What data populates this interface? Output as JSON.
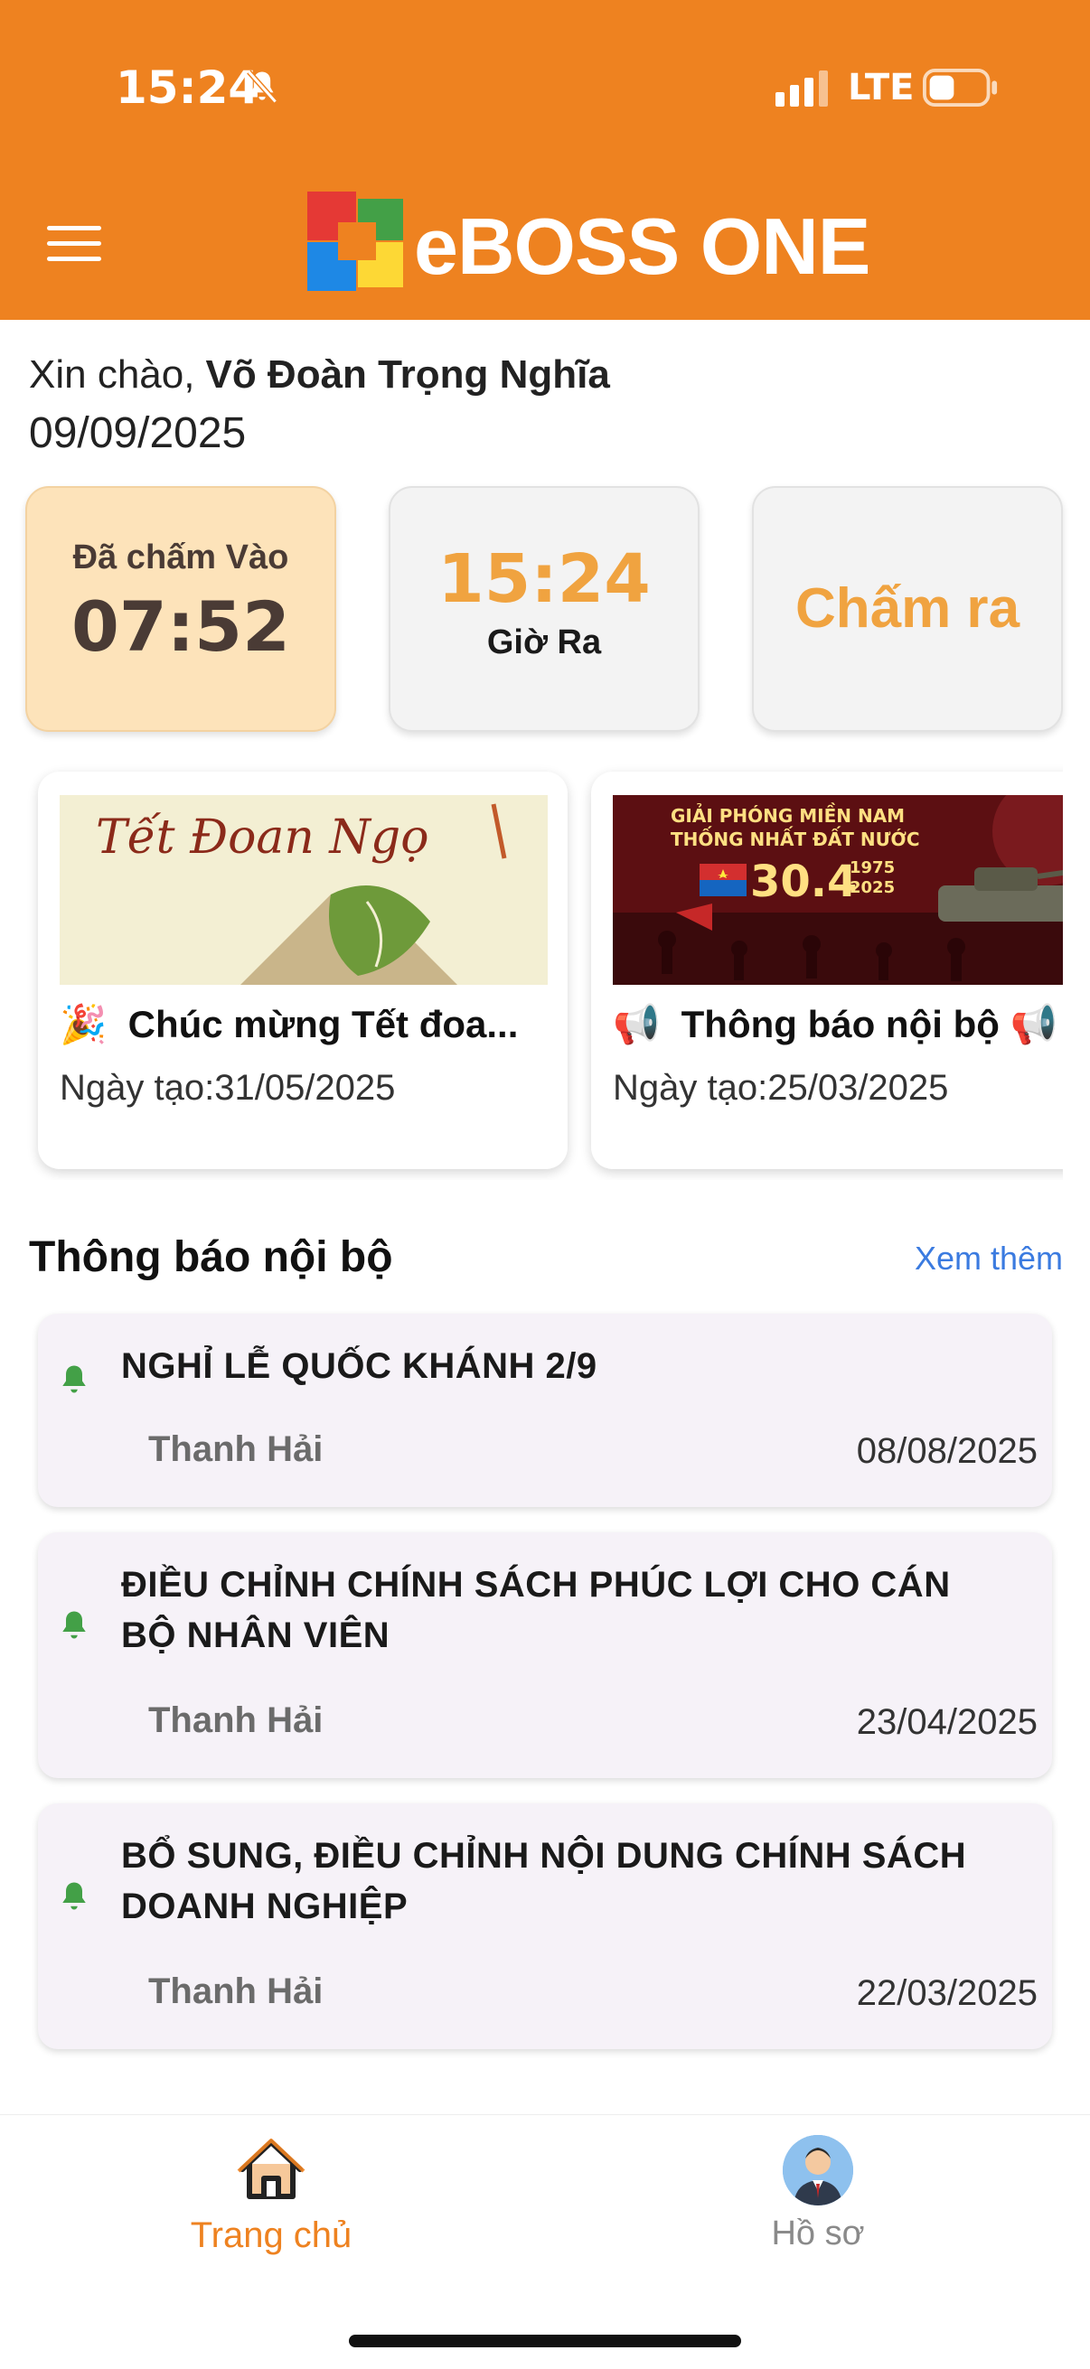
{
  "status_bar": {
    "time": "15:24",
    "network": "LTE",
    "icons": [
      "bell-slash-icon",
      "signal-icon",
      "battery-icon"
    ]
  },
  "header": {
    "app_name": "eBOSS ONE",
    "menu_icon": "hamburger-icon",
    "bg_color": "#EE8220"
  },
  "greeting": {
    "label": "Xin chào,",
    "name": "Võ Đoàn Trọng Nghĩa",
    "date": "09/09/2025"
  },
  "timecards": {
    "checked_in_label": "Đã chấm Vào",
    "checked_in_time": "07:52",
    "current_time": "15:24",
    "checkout_label": "Giờ Ra",
    "checkout_action": "Chấm ra"
  },
  "news": [
    {
      "emoji": "🎉",
      "title": "Chúc mừng Tết đoa...",
      "date_label": "Ngày tạo:31/05/2025",
      "image_text": "Tết Đoan Ngọ"
    },
    {
      "emoji": "📢",
      "title": "Thông báo nội bộ 📢",
      "date_label": "Ngày tạo:25/03/2025",
      "image_text": [
        "GIẢI PHÓNG MIỀN NAM",
        "THỐNG NHẤT ĐẤT NƯỚC",
        "30.4",
        "1975",
        "2025"
      ]
    }
  ],
  "notices_section": {
    "title": "Thông báo nội bộ",
    "see_more": "Xem thêm"
  },
  "notices": [
    {
      "title": "NGHỈ LỄ QUỐC KHÁNH 2/9",
      "author": "Thanh Hải",
      "date": "08/08/2025"
    },
    {
      "title": "ĐIỀU CHỈNH CHÍNH SÁCH PHÚC LỢI CHO CÁN BỘ NHÂN VIÊN",
      "author": "Thanh Hải",
      "date": "23/04/2025"
    },
    {
      "title": "BỔ SUNG, ĐIỀU CHỈNH NỘI DUNG CHÍNH SÁCH DOANH NGHIỆP",
      "author": "Thanh Hải",
      "date": "22/03/2025"
    }
  ],
  "bottom_nav": {
    "home": "Trang chủ",
    "profile": "Hồ sơ",
    "active": "home",
    "active_color": "#EE8220"
  }
}
